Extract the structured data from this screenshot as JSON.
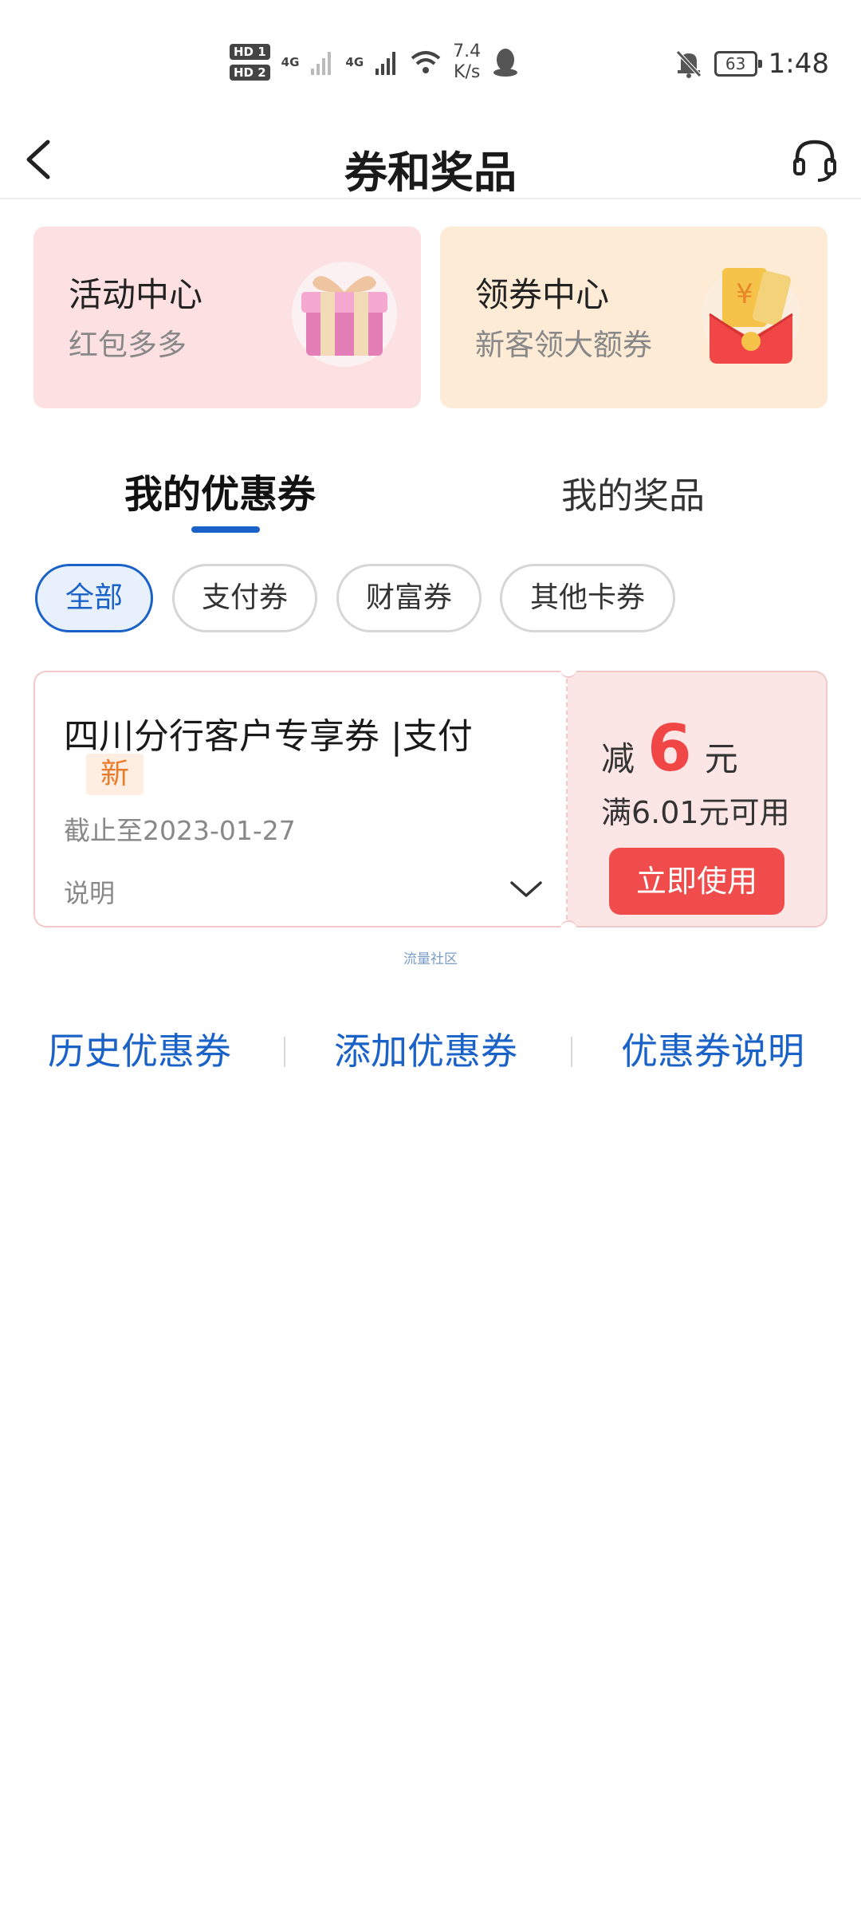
{
  "status_bar": {
    "sim1": "HD 1",
    "sim2": "HD 2",
    "net1": "4G",
    "net2": "4G",
    "speed_value": "7.4",
    "speed_unit": "K/s",
    "battery": "63",
    "time": "1:48"
  },
  "header": {
    "title": "券和奖品"
  },
  "entry_cards": [
    {
      "title": "活动中心",
      "subtitle": "红包多多",
      "icon": "gift-box-icon"
    },
    {
      "title": "领券中心",
      "subtitle": "新客领大额券",
      "icon": "red-envelope-icon"
    }
  ],
  "tabs": [
    {
      "label": "我的优惠券",
      "active": true
    },
    {
      "label": "我的奖品",
      "active": false
    }
  ],
  "filters": [
    {
      "label": "全部",
      "selected": true
    },
    {
      "label": "支付券",
      "selected": false
    },
    {
      "label": "财富券",
      "selected": false
    },
    {
      "label": "其他卡券",
      "selected": false
    }
  ],
  "coupon": {
    "name": "四川分行客户专享券 |支付",
    "tag": "新",
    "expire": "截止至2023-01-27",
    "desc_label": "说明",
    "discount_prefix": "减",
    "discount_value": "6",
    "discount_unit": "元",
    "condition": "满6.01元可用",
    "button_label": "立即使用"
  },
  "watermark": "流量社区",
  "bottom_links": [
    "历史优惠券",
    "添加优惠券",
    "优惠券说明"
  ],
  "colors": {
    "accent_blue": "#1a62c7",
    "accent_red": "#f04646",
    "tag_orange": "#ea7b2a",
    "activity_bg": "#fde1e2",
    "coupon_center_bg": "#fdebd6"
  }
}
